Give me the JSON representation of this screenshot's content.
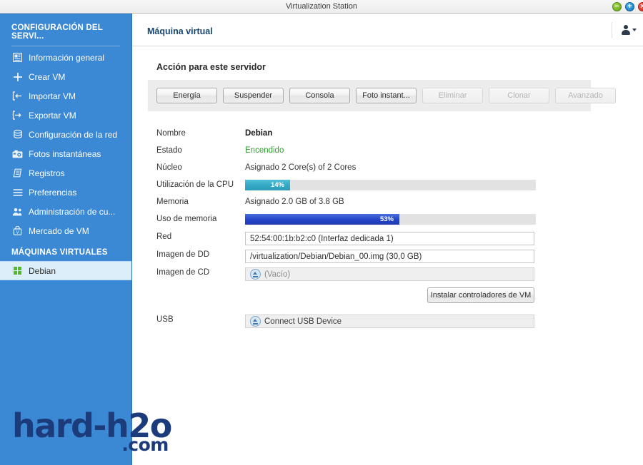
{
  "window": {
    "title": "Virtualization Station",
    "controls": [
      {
        "name": "minimize-button",
        "glyph": "−",
        "color": "#5f9e16"
      },
      {
        "name": "maximize-button",
        "glyph": "+",
        "color": "#0d6fb8"
      },
      {
        "name": "close-button",
        "glyph": "×",
        "color": "#cc2115"
      }
    ]
  },
  "sidebar": {
    "heading_server": "CONFIGURACIÓN DEL SERVI...",
    "heading_vms": "MÁQUINAS VIRTUALES",
    "items": [
      {
        "label": "Información general",
        "icon": "info-panel-icon"
      },
      {
        "label": "Crear VM",
        "icon": "plus-icon"
      },
      {
        "label": "Importar VM",
        "icon": "import-arrow-icon"
      },
      {
        "label": "Exportar VM",
        "icon": "export-arrow-icon"
      },
      {
        "label": "Configuración de la red",
        "icon": "network-stack-icon"
      },
      {
        "label": "Fotos instantáneas",
        "icon": "camera-icon"
      },
      {
        "label": "Registros",
        "icon": "log-book-icon"
      },
      {
        "label": "Preferencias",
        "icon": "sliders-icon"
      },
      {
        "label": "Administración de cu...",
        "icon": "users-icon"
      },
      {
        "label": "Mercado de VM",
        "icon": "marketplace-icon"
      }
    ],
    "vm_items": [
      {
        "label": "Debian",
        "icon": "vm-grid-icon",
        "selected": true
      }
    ]
  },
  "header": {
    "title": "Máquina virtual",
    "user_menu_icon": "user-icon"
  },
  "main": {
    "section_title": "Acción para este servidor",
    "actions": [
      {
        "label": "Energía",
        "disabled": false
      },
      {
        "label": "Suspender",
        "disabled": false
      },
      {
        "label": "Consola",
        "disabled": false
      },
      {
        "label": "Foto instant...",
        "disabled": false
      },
      {
        "label": "Eliminar",
        "disabled": true
      },
      {
        "label": "Clonar",
        "disabled": true
      },
      {
        "label": "Avanzado",
        "disabled": true
      }
    ],
    "details": {
      "nombre_label": "Nombre",
      "nombre_value": "Debian",
      "estado_label": "Estado",
      "estado_value": "Encendido",
      "nucleo_label": "Núcleo",
      "nucleo_value": "Asignado 2 Core(s) of 2 Cores",
      "cpu_label": "Utilización de la CPU",
      "cpu_percent_text": "14%",
      "cpu_percent": 14,
      "memoria_label": "Memoria",
      "memoria_value": "Asignado 2.0 GB of 3.8 GB",
      "uso_memoria_label": "Uso de memoria",
      "uso_memoria_percent_text": "53%",
      "uso_memoria_percent": 53,
      "red_label": "Red",
      "red_value": "52:54:00:1b:b2:c0 (Interfaz dedicada 1)",
      "dd_label": "Imagen de DD",
      "dd_value": "/virtualization/Debian/Debian_00.img (30,0 GB)",
      "cd_label": "Imagen de CD",
      "cd_value": "(Vacío)",
      "usb_label": "USB",
      "usb_value": "Connect USB Device",
      "install_drivers_label": "Instalar controladores de VM"
    }
  },
  "watermark": {
    "main": "hard-h2o",
    "suffix": ".com"
  },
  "colors": {
    "sidebar_blue": "#3b88d4",
    "accent_title": "#17456f",
    "state_green": "#2f9e32",
    "cpu_bar": "#2d9bb8",
    "mem_bar": "#1f39b4"
  }
}
